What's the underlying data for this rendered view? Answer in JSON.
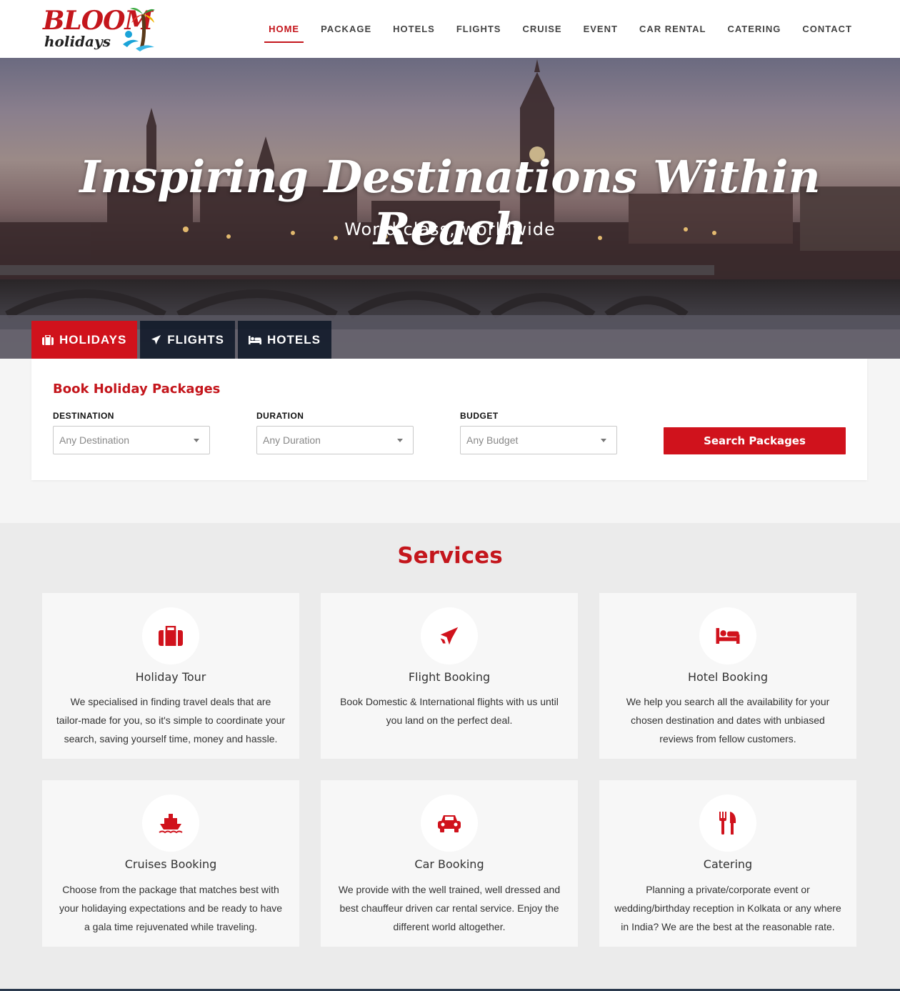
{
  "brand": {
    "name_top": "BLOOM",
    "name_bottom": "holidays"
  },
  "nav": {
    "items": [
      {
        "label": "HOME",
        "active": true
      },
      {
        "label": "PACKAGE"
      },
      {
        "label": "HOTELS"
      },
      {
        "label": "FLIGHTS"
      },
      {
        "label": "CRUISE"
      },
      {
        "label": "EVENT"
      },
      {
        "label": "CAR RENTAL"
      },
      {
        "label": "CATERING"
      },
      {
        "label": "CONTACT"
      }
    ]
  },
  "hero": {
    "title": "Inspiring Destinations Within Reach",
    "subtitle": "World class, worldwide"
  },
  "tabs": [
    {
      "label": "HOLIDAYS",
      "icon": "suitcase-icon",
      "active": true
    },
    {
      "label": "FLIGHTS",
      "icon": "plane-icon"
    },
    {
      "label": "HOTELS",
      "icon": "bed-icon"
    }
  ],
  "search": {
    "title": "Book Holiday Packages",
    "fields": [
      {
        "label": "DESTINATION",
        "value": "Any Destination"
      },
      {
        "label": "DURATION",
        "value": "Any Duration"
      },
      {
        "label": "BUDGET",
        "value": "Any Budget"
      }
    ],
    "button": "Search Packages"
  },
  "services": {
    "title": "Services",
    "items": [
      {
        "title": "Holiday Tour",
        "icon": "suitcase-icon",
        "lines": [
          "We specialised in finding travel deals that are",
          "tailor-made for you, so it's simple to coordinate your",
          "search, saving yourself time, money and hassle."
        ]
      },
      {
        "title": "Flight Booking",
        "icon": "plane-icon",
        "lines": [
          "Book Domestic & International flights with us until",
          "you land on the perfect deal."
        ]
      },
      {
        "title": "Hotel Booking",
        "icon": "bed-icon",
        "lines": [
          "We help you search all the availability for your",
          "chosen destination and dates with unbiased",
          "reviews from fellow customers."
        ]
      },
      {
        "title": "Cruises Booking",
        "icon": "ship-icon",
        "lines": [
          "Choose from the package that matches best with",
          "your holidaying expectations and be ready to have",
          "a gala time rejuvenated while traveling."
        ]
      },
      {
        "title": "Car Booking",
        "icon": "car-icon",
        "lines": [
          "We provide with the well trained, well dressed and",
          "best chauffeur driven car rental service. Enjoy the",
          "different world altogether."
        ]
      },
      {
        "title": "Catering",
        "icon": "cutlery-icon",
        "lines": [
          "Planning a private/corporate event or",
          "wedding/birthday reception in Kolkata or any where",
          "in India? We are the best at the reasonable rate."
        ]
      }
    ]
  },
  "colors": {
    "accent": "#c4161c",
    "tab_bg": "#0a1423",
    "card_bg": "#f7f7f7"
  }
}
